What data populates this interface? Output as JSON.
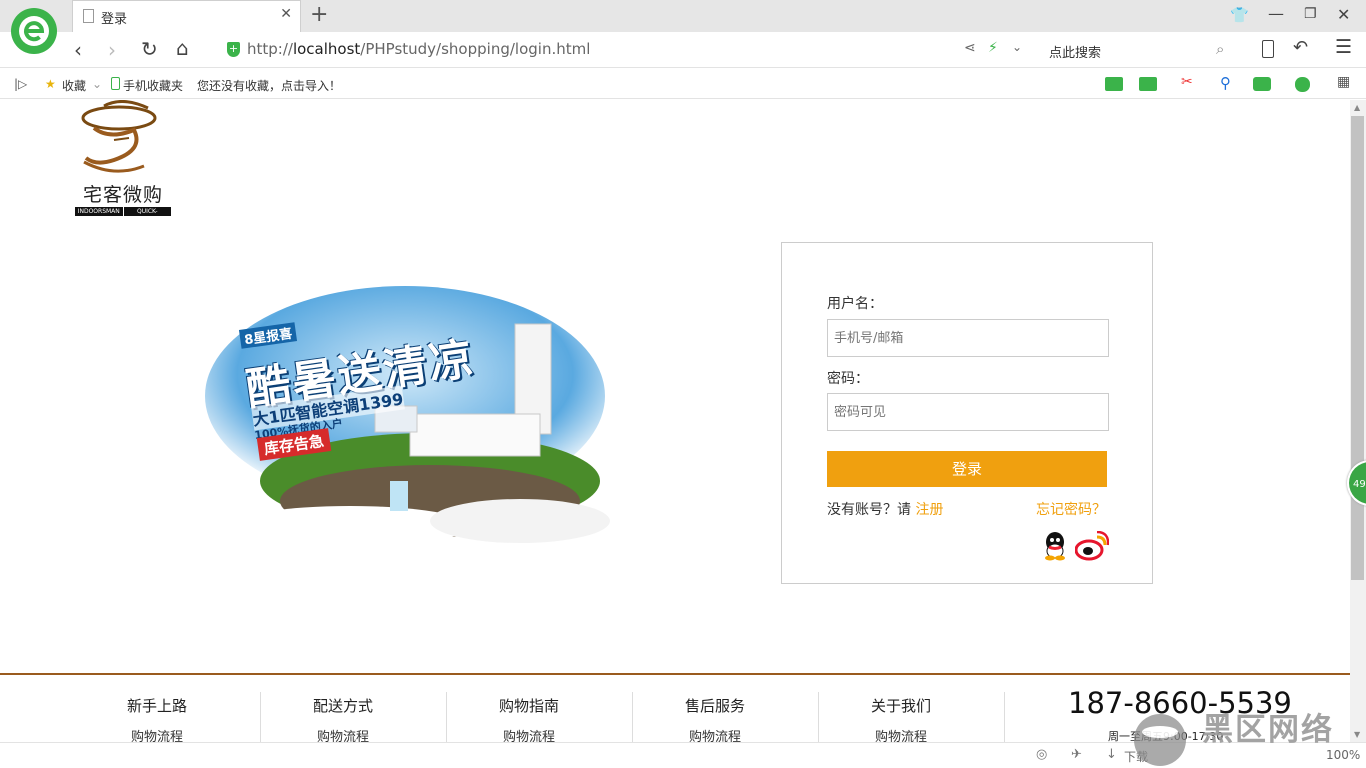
{
  "browser": {
    "tab_title": "登录",
    "new_tab": "+",
    "url_prefix": "http://",
    "url_host": "localhost",
    "url_path": "/PHPstudy/shopping/login.html",
    "search_placeholder": "点此搜索"
  },
  "bookmarks": {
    "favorites": "收藏",
    "mobile": "手机收藏夹",
    "hint": "您还没有收藏，点击导入！"
  },
  "logo": {
    "name": "宅客微购",
    "tag_left": "INDOORSMAN",
    "tag_right": "QUICK-SHOPPING"
  },
  "banner": {
    "tag": "8星报喜",
    "title": "酷暑送清凉",
    "subtitle": "大1匹智能空调1399",
    "sub2": "100%抚货的入户",
    "badge": "库存告急"
  },
  "login": {
    "username_label": "用户名：",
    "username_placeholder": "手机号/邮箱",
    "password_label": "密码：",
    "password_placeholder": "密码可见",
    "submit": "登录",
    "no_account": "没有账号？请 ",
    "register": "注册",
    "forgot": "忘记密码？"
  },
  "footer": {
    "columns": [
      {
        "title": "新手上路",
        "link": "购物流程"
      },
      {
        "title": "配送方式",
        "link": "购物流程"
      },
      {
        "title": "购物指南",
        "link": "购物流程"
      },
      {
        "title": "售后服务",
        "link": "购物流程"
      },
      {
        "title": "关于我们",
        "link": "购物流程"
      }
    ],
    "phone": "187-8660-5539",
    "hours": "周一至周五9:00-17:30"
  },
  "status": {
    "download": "下载",
    "zoom": "100%"
  },
  "edge_badge": "49",
  "watermark": "黑区网络",
  "colors": {
    "accent": "#f0a00f",
    "footer_line": "#9a5b1e",
    "browser_green": "#3aa645"
  }
}
